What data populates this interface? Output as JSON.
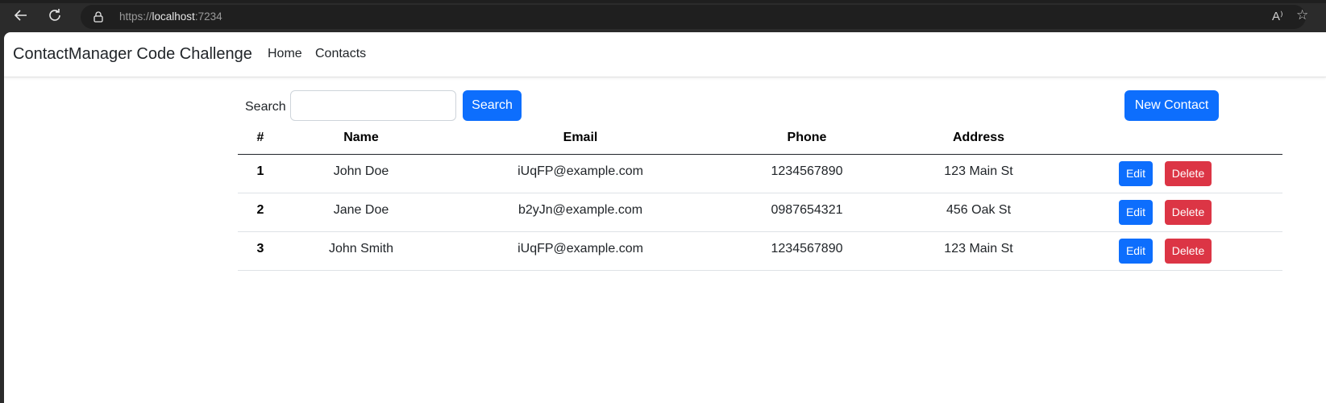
{
  "browser": {
    "url_scheme": "https://",
    "url_host": "localhost",
    "url_port": ":7234",
    "back_icon": "back-arrow-icon",
    "refresh_icon": "refresh-icon",
    "lock_icon": "lock-icon",
    "read_aloud_icon": "read-aloud-icon",
    "favorite_icon": "star-icon",
    "read_aloud_label": "A⁾",
    "favorite_label": "☆"
  },
  "navbar": {
    "brand": "ContactManager Code Challenge",
    "links": [
      "Home",
      "Contacts"
    ]
  },
  "search": {
    "label": "Search",
    "value": "",
    "placeholder": "",
    "button_label": "Search"
  },
  "new_contact_label": "New Contact",
  "table": {
    "headers": [
      "#",
      "Name",
      "Email",
      "Phone",
      "Address"
    ],
    "rows": [
      {
        "num": "1",
        "name": "John Doe",
        "email": "iUqFP@example.com",
        "phone": "1234567890",
        "address": "123 Main St",
        "edit": "Edit",
        "delete": "Delete"
      },
      {
        "num": "2",
        "name": "Jane Doe",
        "email": "b2yJn@example.com",
        "phone": "0987654321",
        "address": "456 Oak St",
        "edit": "Edit",
        "delete": "Delete"
      },
      {
        "num": "3",
        "name": "John Smith",
        "email": "iUqFP@example.com",
        "phone": "1234567890",
        "address": "123 Main St",
        "edit": "Edit",
        "delete": "Delete"
      }
    ]
  },
  "colors": {
    "primary": "#0d6efd",
    "danger": "#dc3545",
    "browser_chrome": "#2b2b2b"
  }
}
